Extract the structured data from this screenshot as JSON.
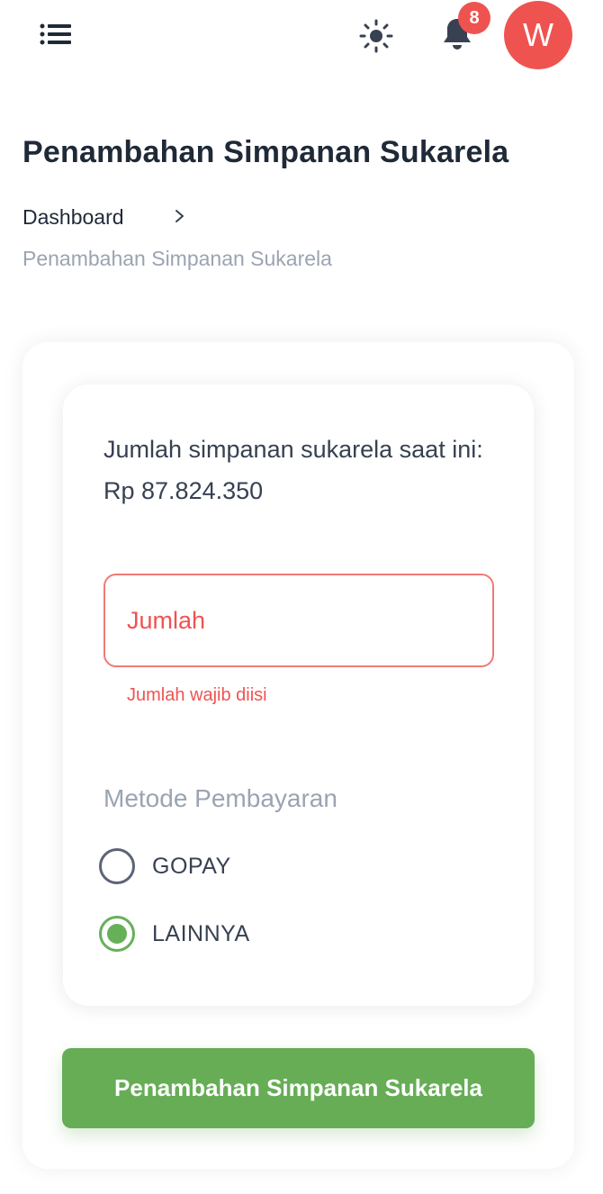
{
  "header": {
    "menu_icon": "menu-icon",
    "theme_icon": "sun-icon",
    "notification_icon": "bell-icon",
    "notification_count": "8",
    "avatar_initial": "W"
  },
  "page": {
    "title": "Penambahan Simpanan Sukarela"
  },
  "breadcrumb": {
    "home": "Dashboard",
    "current": "Penambahan Simpanan Sukarela"
  },
  "form": {
    "balance_text": "Jumlah simpanan sukarela saat ini: Rp 87.824.350",
    "amount_placeholder": "Jumlah",
    "amount_value": "",
    "amount_error": "Jumlah wajib diisi",
    "payment_method_label": "Metode Pembayaran",
    "payment_options": [
      {
        "label": "GOPAY",
        "selected": false
      },
      {
        "label": "LAINNYA",
        "selected": true
      }
    ],
    "submit_label": "Penambahan Simpanan Sukarela"
  },
  "colors": {
    "accent_green": "#66ad56",
    "error_red": "#ef5350",
    "muted_text": "#9aa4b2",
    "dark_text": "#1f2937"
  }
}
